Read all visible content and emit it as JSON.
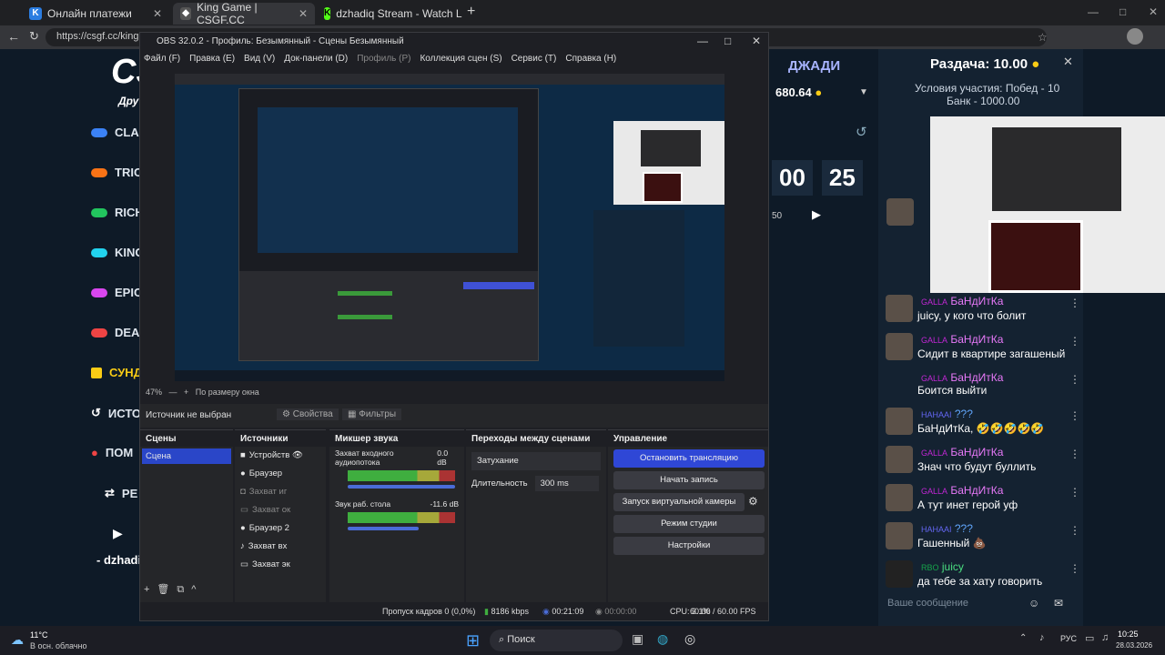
{
  "browser": {
    "tabs": [
      {
        "label": "Онлайн платежи",
        "icon": "card-icon",
        "color": "#2b7de1"
      },
      {
        "label": "King Game | CSGF.CC",
        "icon": "shield-icon",
        "color": "#333"
      },
      {
        "label": "dzhadiq Stream - Watch Live on K",
        "icon": "kick-icon",
        "color": "#53fc18"
      }
    ],
    "url": "https://csgf.cc/king"
  },
  "site": {
    "logo": "CS",
    "logo_sub": "Дру",
    "sidebar": [
      {
        "label": "CLAS",
        "color": "#3b82f6"
      },
      {
        "label": "TRIC",
        "color": "#f97316"
      },
      {
        "label": "RICH",
        "color": "#22c55e"
      },
      {
        "label": "KING",
        "color": "#22d3ee"
      },
      {
        "label": "EPIC",
        "color": "#d946ef"
      },
      {
        "label": "DEAL",
        "color": "#ef4444"
      },
      {
        "label": "СУНД",
        "color": "#facc15"
      },
      {
        "label": "ИСТО",
        "color": "#ffffff"
      },
      {
        "label": "ПОМ",
        "color": "#ef4444"
      },
      {
        "label": "РЕ",
        "color": "#ffffff"
      },
      {
        "label": "- dzhadi",
        "color": "#ffffff"
      }
    ],
    "player_name": "ДЖАДИ",
    "balance": "680.64",
    "timer_min": "00",
    "timer_sec": "25",
    "timer_small": "50"
  },
  "giveaway": {
    "title": "Раздача:",
    "amount": "10.00",
    "cond": "Условия участия: Побед - 10",
    "bank": "Банк - 1000.00"
  },
  "chat": [
    {
      "badge": "GALLA",
      "badge_color": "#c026d3",
      "name": "БаНдИтКа",
      "name_color": "#e879f9",
      "text": "juicy, у кого что болит"
    },
    {
      "badge": "GALLA",
      "badge_color": "#c026d3",
      "name": "БаНдИтКа",
      "name_color": "#e879f9",
      "text": "Сидит в квартире загашеный"
    },
    {
      "badge": "GALLA",
      "badge_color": "#c026d3",
      "name": "БаНдИтКа",
      "name_color": "#e879f9",
      "text": "Боится выйти"
    },
    {
      "badge": "HAHAAI",
      "badge_color": "#6366f1",
      "name": "???",
      "name_color": "#60a5fa",
      "text": "БаНдИтКа, 🤣🤣🤣🤣🤣"
    },
    {
      "badge": "GALLA",
      "badge_color": "#c026d3",
      "name": "БаНдИтКа",
      "name_color": "#e879f9",
      "text": "Знач что будут буллить"
    },
    {
      "badge": "GALLA",
      "badge_color": "#c026d3",
      "name": "БаНдИтКа",
      "name_color": "#e879f9",
      "text": "А тут инет герой уф"
    },
    {
      "badge": "HAHAAI",
      "badge_color": "#6366f1",
      "name": "???",
      "name_color": "#60a5fa",
      "text": "Гашенный 💩"
    },
    {
      "badge": "RBO",
      "badge_color": "#16a34a",
      "name": "juicy",
      "name_color": "#4ade80",
      "text": "да тебе за хату говорить"
    }
  ],
  "chat_placeholder": "Ваше сообщение",
  "obs": {
    "title": "OBS 32.0.2 - Профиль: Безымянный - Сцены Безымянный",
    "menu": [
      "Файл (F)",
      "Правка (E)",
      "Вид (V)",
      "Док-панели (D)",
      "Профиль (P)",
      "Коллекция сцен (S)",
      "Сервис (T)",
      "Справка (H)"
    ],
    "zoom": "47%",
    "fit": "По размеру окна",
    "no_source": "Источник не выбран",
    "props": "Свойства",
    "filters": "Фильтры",
    "docks": {
      "scenes": "Сцены",
      "sources": "Источники",
      "mixer": "Микшер звука",
      "transitions": "Переходы между сценами",
      "controls": "Управление"
    },
    "scene_items": [
      "Сцена"
    ],
    "source_items": [
      "Устройств",
      "Браузер",
      "Захват иг",
      "Захват ок",
      "Браузер 2",
      "Захват вх",
      "Захват эк"
    ],
    "mixer": [
      {
        "name": "Захват входного аудиопотока",
        "db": "0.0 dB"
      },
      {
        "name": "Звук раб. стола",
        "db": "-11.6 dB"
      }
    ],
    "transition": "Затухание",
    "duration_label": "Длительность",
    "duration": "300 ms",
    "controls": [
      "Остановить трансляцию",
      "Начать запись",
      "Запуск виртуальной камеры",
      "Режим студии",
      "Настройки"
    ],
    "status": {
      "dropped": "Пропуск кадров 0 (0,0%)",
      "kbps": "8186 kbps",
      "live": "00:21:09",
      "rec": "00:00:00",
      "cpu": "CPU: 3.1%",
      "fps": "60.00 / 60.00 FPS"
    }
  },
  "taskbar": {
    "weather_temp": "11°C",
    "weather_desc": "В осн. облачно",
    "search": "Поиск",
    "lang": "РУС",
    "time": "10:25",
    "date": "28.03.2026"
  }
}
